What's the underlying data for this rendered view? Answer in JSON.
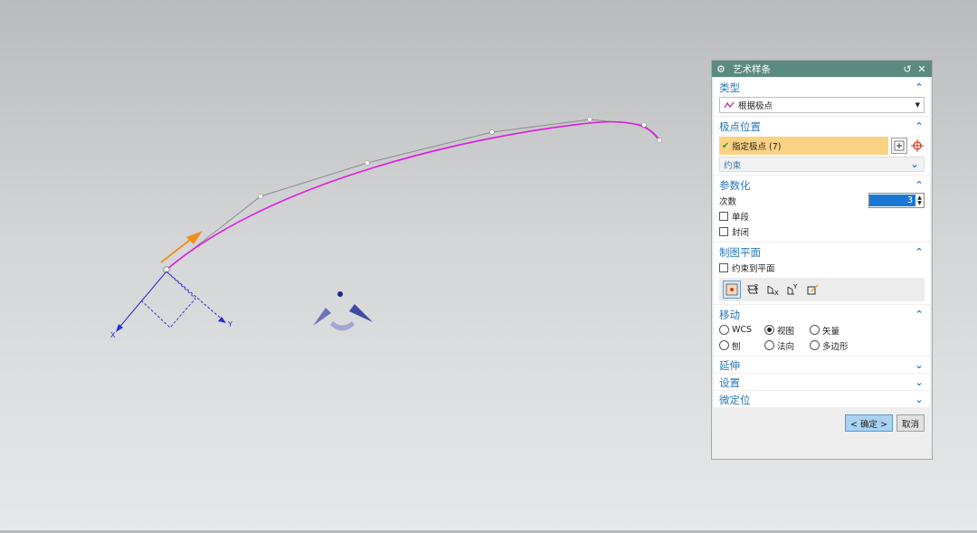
{
  "dialog": {
    "title": "艺术样条",
    "sections": {
      "type": {
        "title": "类型",
        "dropdown_value": "根据极点"
      },
      "pole_position": {
        "title": "极点位置",
        "selection_label": "指定极点 (7)",
        "constraint_label": "约束"
      },
      "parameterization": {
        "title": "参数化",
        "degree_label": "次数",
        "degree_value": "3",
        "single_segment_label": "单段",
        "closed_label": "封闭"
      },
      "drawing_plane": {
        "title": "制图平面",
        "constrain_to_plane_label": "约束到平面",
        "plane_icons": [
          "view-plane-icon",
          "xy-plane-icon",
          "yz-plane-icon",
          "zx-plane-icon",
          "define-plane-icon"
        ]
      },
      "move": {
        "title": "移动",
        "options": [
          "WCS",
          "视图",
          "矢量",
          "刨",
          "法向",
          "多边形"
        ],
        "selected": "视图"
      },
      "extend": {
        "title": "延伸"
      },
      "settings": {
        "title": "设置"
      },
      "micro_position": {
        "title": "微定位"
      }
    },
    "ok_label": "< 确定 >",
    "cancel_label": "取消"
  },
  "viewport": {
    "axis_x_label": "X",
    "axis_y_label": "Y",
    "curve_color": "#e01ae0",
    "polygon_color": "#8c8c8c",
    "axis_color": "#2a2ad0",
    "arrow_color": "#f0901e"
  }
}
